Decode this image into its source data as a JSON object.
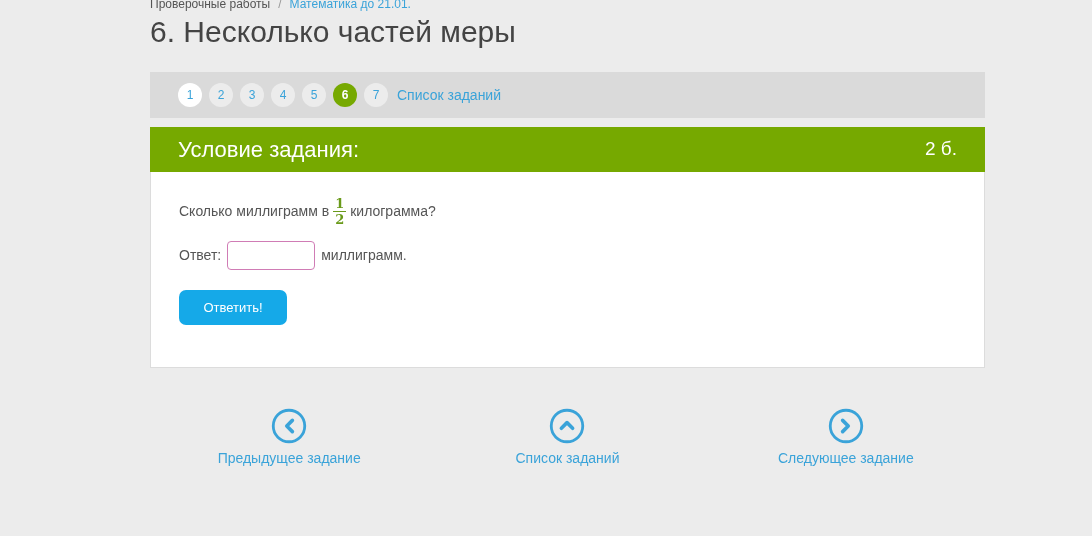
{
  "breadcrumbs": [
    {
      "label": "Проверочные работы",
      "link": false
    },
    {
      "label": "Математика до 21.01.",
      "link": true
    }
  ],
  "breadcrumb_separator": "/",
  "title": "6. Несколько частей меры",
  "task_nav": {
    "items": [
      {
        "label": "1",
        "selected": false,
        "visited": true
      },
      {
        "label": "2",
        "selected": false,
        "visited": false
      },
      {
        "label": "3",
        "selected": false,
        "visited": false
      },
      {
        "label": "4",
        "selected": false,
        "visited": false
      },
      {
        "label": "5",
        "selected": false,
        "visited": false
      },
      {
        "label": "6",
        "selected": true,
        "visited": false
      },
      {
        "label": "7",
        "selected": false,
        "visited": false
      }
    ],
    "list_link": "Список заданий"
  },
  "task": {
    "header": "Условие задания:",
    "points": "2 б.",
    "question_before": "Сколько миллиграмм в",
    "fraction": {
      "numerator": "1",
      "denominator": "2"
    },
    "question_after": "килограмма?",
    "answer_label": "Ответ:",
    "answer_unit": "миллиграмм.",
    "submit": "Ответить!"
  },
  "bottom_nav": [
    {
      "kind": "prev",
      "label": "Предыдущее задание"
    },
    {
      "kind": "up",
      "label": "Список заданий"
    },
    {
      "kind": "next",
      "label": "Следующее задание"
    }
  ]
}
